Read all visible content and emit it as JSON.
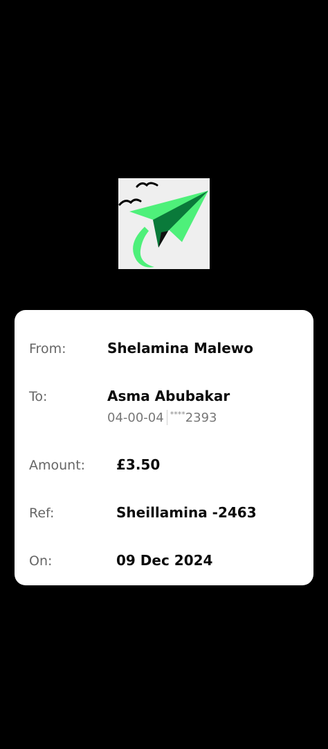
{
  "logo": {
    "icon": "paper-plane-logo-icon",
    "colors": {
      "plane": "#4ef07a",
      "plane_dark": "#0a7a3a",
      "background": "#efefef"
    }
  },
  "receipt": {
    "from": {
      "label": "From:",
      "value": "Shelamina Malewo"
    },
    "to": {
      "label": "To:",
      "value": "Asma Abubakar",
      "sort_code": "04-00-04",
      "account_mask": "****",
      "account_last": "2393"
    },
    "amount": {
      "label": "Amount:",
      "value": "£3.50"
    },
    "ref": {
      "label": "Ref:",
      "value": "Sheillamina -2463"
    },
    "on": {
      "label": "On:",
      "value": "09 Dec 2024"
    }
  }
}
